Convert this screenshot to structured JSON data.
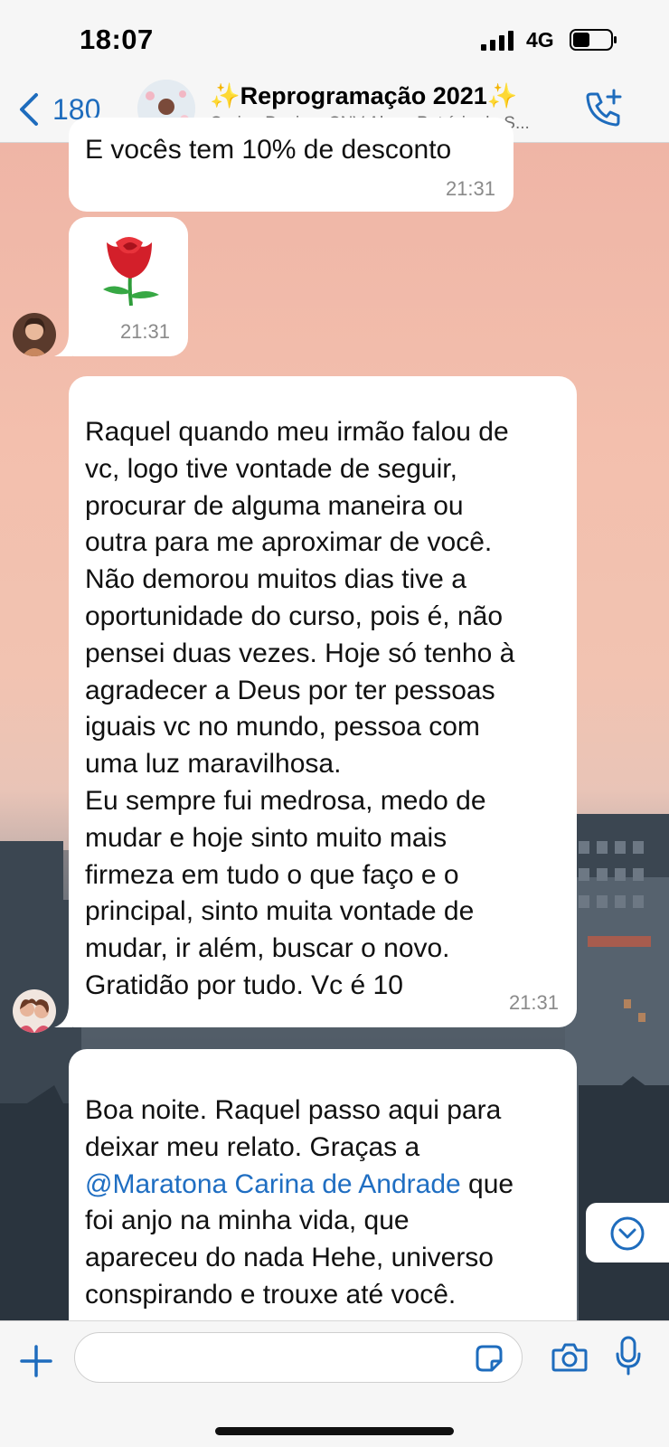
{
  "status_bar": {
    "time": "18:07",
    "network": "4G",
    "icons": [
      "signal-icon",
      "battery-icon"
    ]
  },
  "header": {
    "back_count": "180",
    "title": "✨Reprogramação 2021✨",
    "subtitle": "Carina Design, CNV Alana Patrícia da S...",
    "icons": [
      "chevron-left-icon",
      "phone-add-icon"
    ]
  },
  "messages": [
    {
      "text": "E vocês tem 10% de desconto",
      "time": "21:31"
    },
    {
      "emoji": "🌹",
      "time": "21:31"
    },
    {
      "text": "Raquel quando meu irmão falou de\nvc, logo tive vontade de seguir,\nprocurar de alguma maneira ou\noutra para me aproximar de você.\nNão demorou muitos dias tive a\noportunidade do curso, pois é, não\npensei duas vezes. Hoje só tenho à\nagradecer a Deus por ter pessoas\niguais vc no mundo, pessoa com\numa luz maravilhosa.\nEu sempre fui medrosa, medo de\nmudar e hoje sinto muito mais\nfirmeza em tudo o que faço e o\nprincipal, sinto muita vontade de\nmudar, ir além, buscar o novo.\nGratidão por tudo. Vc é 10",
      "time": "21:31"
    },
    {
      "text_before": "Boa noite. Raquel passo aqui para\ndeixar meu relato. Graças a\n",
      "mention": "@Maratona Carina de Andrade",
      "text_after": " que\nfoi anjo na minha vida, que\napareceu do nada Hehe, universo\nconspirando e trouxe até você."
    }
  ],
  "composer": {
    "placeholder": "",
    "icons": [
      "plus-icon",
      "sticker-icon",
      "camera-icon",
      "microphone-icon"
    ]
  },
  "colors": {
    "accent": "#1e6cbd",
    "mention": "#1f6ec2",
    "bubble": "#ffffff",
    "sky": "#f3bfad"
  }
}
